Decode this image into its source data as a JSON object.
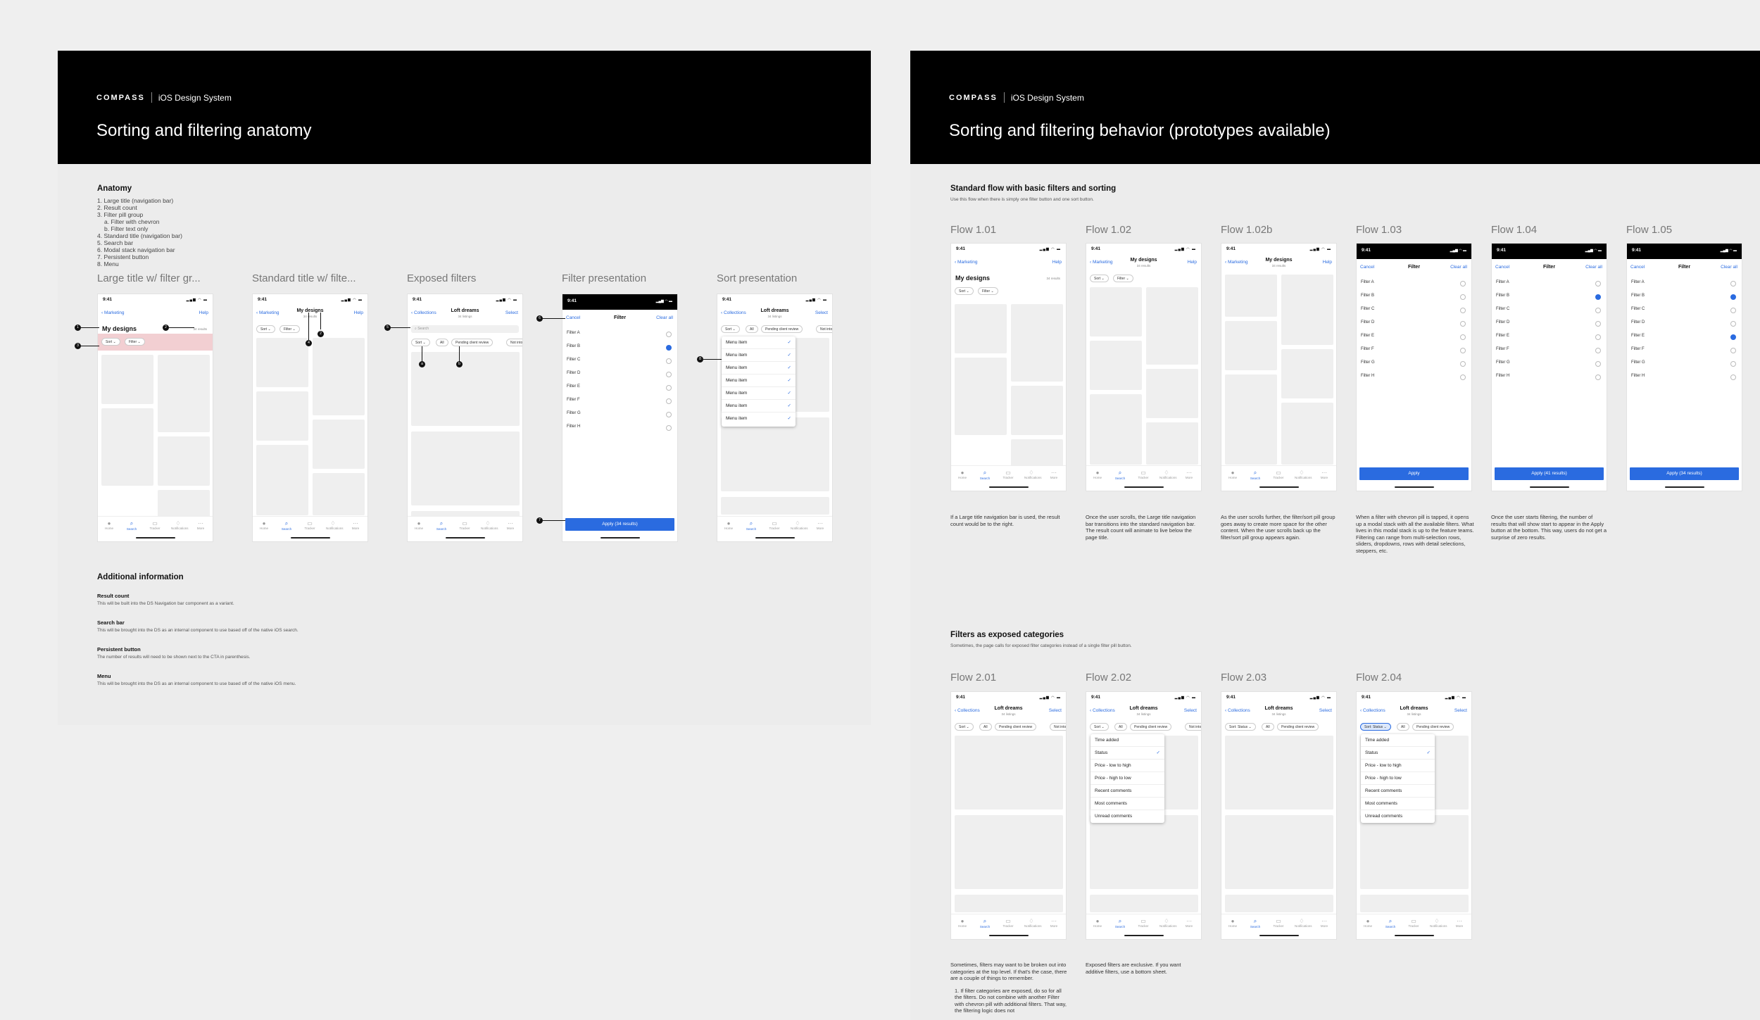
{
  "board1": {
    "brand": "COMPASS",
    "system": "iOS Design System",
    "title": "Sorting and filtering anatomy",
    "anatomy_title": "Anatomy",
    "anatomy_items": [
      "1. Large title (navigation bar)",
      "2. Result count",
      "3. Filter pill group",
      "a. Filter with chevron",
      "b. Filter text only",
      "4. Standard title (navigation bar)",
      "5. Search bar",
      "6. Modal stack navigation bar",
      "7. Persistent button",
      "8. Menu"
    ],
    "columns": [
      "Large title w/ filter gr...",
      "Standard title w/ filte...",
      "Exposed filters",
      "Filter presentation",
      "Sort presentation"
    ],
    "additional_title": "Additional information",
    "additional": [
      {
        "h": "Result count",
        "t": "This will be built into the DS Navigation bar component as a variant."
      },
      {
        "h": "Search bar",
        "t": "This will be brought into the DS as an internal component to use based off of the native iOS search."
      },
      {
        "h": "Persistent button",
        "t": "The number of results will need to be shown next to the CTA in parenthesis."
      },
      {
        "h": "Menu",
        "t": "This will be brought into the DS as an internal component to use based off of the native iOS menu."
      }
    ]
  },
  "board2": {
    "brand": "COMPASS",
    "system": "iOS Design System",
    "title": "Sorting and filtering behavior (prototypes available)",
    "sec1_title": "Standard flow with basic filters and sorting",
    "sec1_sub": "Use this flow when there is simply one filter button and one sort button.",
    "flows1": [
      "Flow 1.01",
      "Flow 1.02",
      "Flow 1.02b",
      "Flow 1.03",
      "Flow 1.04",
      "Flow 1.05"
    ],
    "desc1": [
      "If a Large title navigation bar is used, the result count would be to the right.",
      "Once the user scrolls, the Large title navigation bar transitions into the standard navigation bar. The result count will animate to live below the page title.",
      "As the user scrolls further, the filter/sort pill group goes away to create more space for the other content. When the user scrolls back up the filter/sort pill group appears again.",
      "When a filter with chevron pill is tapped, it opens up a modal stack with all the available filters. What lives in this modal stack is up to the feature teams. Filtering can range from multi-selection rows, sliders, dropdowns, rows with detail selections, steppers, etc.",
      "Once the user starts filtering, the number of results that will show start to appear in the Apply button at the bottom. This way, users do not get a surprise of zero results.",
      ""
    ],
    "sec2_title": "Filters as exposed categories",
    "sec2_sub": "Sometimes, the page calls for exposed filter categories instead of a single filter pill button.",
    "flows2": [
      "Flow 2.01",
      "Flow 2.02",
      "Flow 2.03",
      "Flow 2.04"
    ],
    "desc2a": "Sometimes, filters may want to be broken out into categories at the top level. If that's the case, there are a couple of things to remember.",
    "desc2a_item": "1. If filter categories are exposed, do so for all the filters. Do not combine with another Filter with chevron pill with additional filters. That way, the filtering logic does not",
    "desc2b": "Exposed filters are exclusive. If you want additive filters, use a bottom sheet."
  },
  "phone": {
    "time": "9:41",
    "status_icons": "▂▄▆ ◠ ▬",
    "back_marketing": "Marketing",
    "help": "Help",
    "my_designs": "My designs",
    "results": "34 results",
    "listings": "34 listings",
    "sort": "Sort",
    "filter": "Filter",
    "back_collections": "Collections",
    "loft": "Loft dreams",
    "select": "Select",
    "search": "Search",
    "all": "All",
    "pending": "Pending client review",
    "not": "Not into",
    "cancel": "Cancel",
    "filter_title": "Filter",
    "clear": "Clear all",
    "filters": [
      "Filter A",
      "Filter B",
      "Filter C",
      "Filter D",
      "Filter E",
      "Filter F",
      "Filter G",
      "Filter H"
    ],
    "apply": "Apply",
    "apply41": "Apply (41 results)",
    "apply34": "Apply (34 results)",
    "menu_item": "Menu item",
    "tabs": [
      "Home",
      "Search",
      "Tracker",
      "Notifications",
      "More"
    ],
    "sort_options": [
      "Time added",
      "Status",
      "Price - low to high",
      "Price - high to low",
      "Recent comments",
      "Most comments",
      "Unread comments"
    ],
    "status_pill": "Status",
    "sort_status": "Sort: Status"
  }
}
